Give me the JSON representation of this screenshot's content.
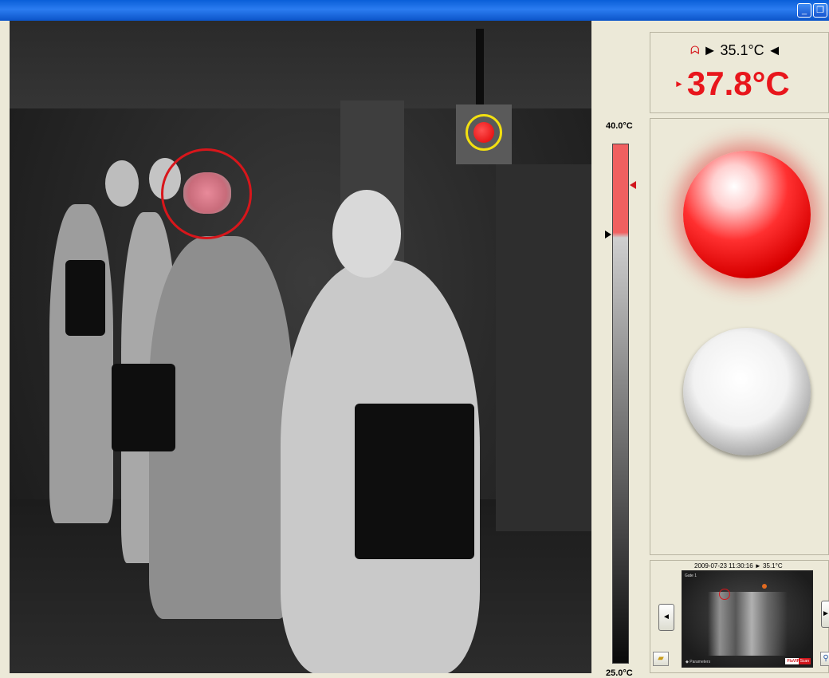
{
  "window": {
    "minimize_icon": "minimize-icon",
    "restore_icon": "restore-icon"
  },
  "thermal_view": {
    "face_marker_color": "#d8161b",
    "reference_marker_color": "#f2e010"
  },
  "scale": {
    "max_label": "40.0°C",
    "min_label": "25.0°C",
    "high_color": "#f06060"
  },
  "readout": {
    "reference_temp": "35.1°C",
    "left_arrow": "►",
    "right_arrow": "◄",
    "measured_arrow": "►",
    "measured_temp": "37.8°C",
    "alarm_color": "#e8161c"
  },
  "alarm_lights": {
    "alarm_state": "active"
  },
  "snapshot": {
    "caption": "2009-07-23 11:30:16  ► 35.1°C",
    "inner_label": "Gate 1",
    "footer_left": "◆ Parameters",
    "logo_a": "FluVIP",
    "logo_b": "Scan",
    "prev_label": "◄",
    "next_label": "►",
    "folder_icon": "folder-icon",
    "search_icon": "magnifier-icon"
  }
}
